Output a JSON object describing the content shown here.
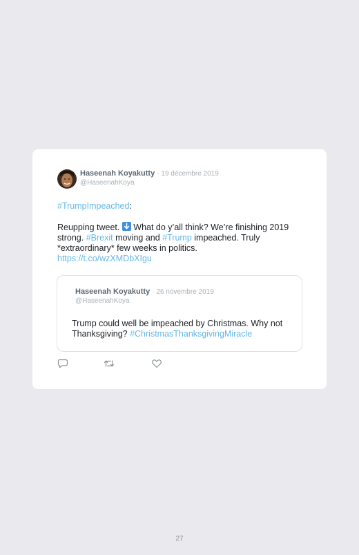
{
  "tweet": {
    "author_name": "Haseenah Koyakutty",
    "date": "· 19 décembre 2019",
    "handle": "@HaseenahKoya",
    "hashtag_line": "#TrumpImpeached",
    "hashtag_suffix": ":",
    "body_1": "Reupping tweet. ",
    "arrow_emoji": "down-arrow-emoji",
    "body_2": " What do y’all think? We’re finishing 2019 strong. ",
    "hashtag_brexit": "#Brexit",
    "body_3": " moving and ",
    "hashtag_trump": "#Trump",
    "body_4": " impeached. Truly *extraordinary* few weeks in politics.",
    "url": "https://t.co/wzXMDbXIgu"
  },
  "quoted_tweet": {
    "author_name": "Haseenah Koyakutty",
    "date": "· 26 novembre 2019",
    "handle": "@HaseenahKoya",
    "body": "Trump could well be impeached by Christmas. Why not Thanksgiving? ",
    "hashtag": "#ChristmasThanksgivingMiracle"
  },
  "actions": {
    "reply_icon": "reply-icon",
    "retweet_icon": "retweet-icon",
    "like_icon": "like-icon"
  },
  "colors": {
    "link": "#65b7e8",
    "background": "#e9e9ee",
    "card": "#ffffff"
  },
  "page": {
    "number": "27"
  }
}
